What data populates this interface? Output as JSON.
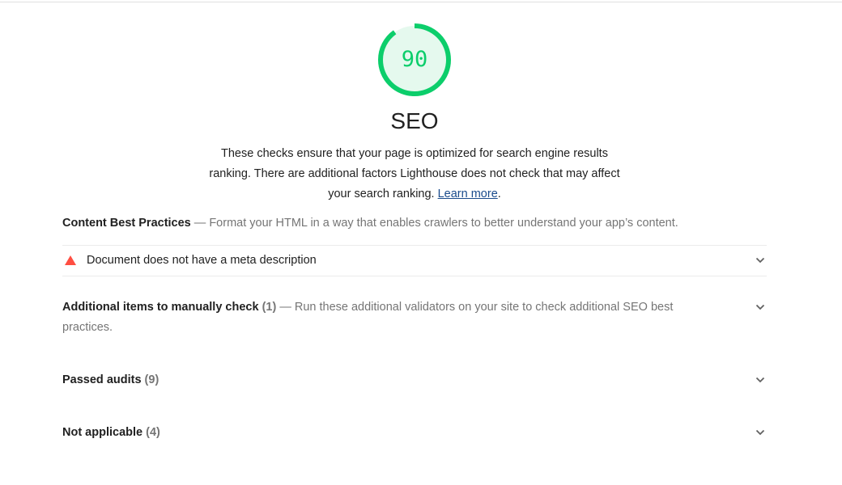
{
  "gauge": {
    "score": "90",
    "fraction": 0.9,
    "color": "#0cce6b",
    "fill_color": "#e5f9ee"
  },
  "category": {
    "title": "SEO",
    "description": "These checks ensure that your page is optimized for search engine results ranking. There are additional factors Lighthouse does not check that may affect your search ranking.",
    "learn_more": "Learn more",
    "period": "."
  },
  "group": {
    "title": "Content Best Practices",
    "separator": " — ",
    "description": "Format your HTML in a way that enables crawlers to better understand your app’s content."
  },
  "failed_audits": [
    {
      "title": "Document does not have a meta description",
      "status_color": "#ff4e42"
    }
  ],
  "clumps": [
    {
      "title": "Additional items to manually check",
      "count": "(1)",
      "separator": " — ",
      "description": "Run these additional validators on your site to check additional SEO best practices."
    },
    {
      "title": "Passed audits",
      "count": "(9)"
    },
    {
      "title": "Not applicable",
      "count": "(4)"
    }
  ]
}
